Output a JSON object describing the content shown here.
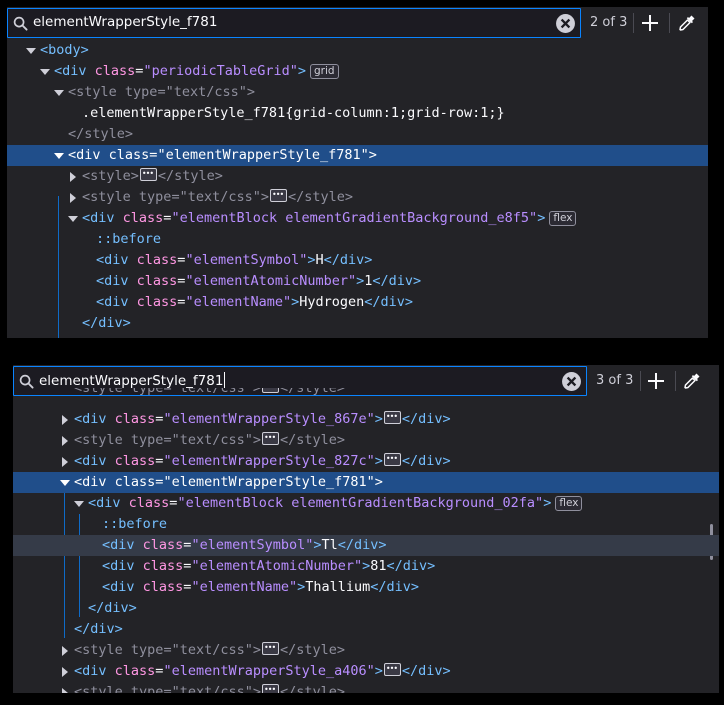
{
  "panel1": {
    "search": {
      "value": "elementWrapperStyle_f781",
      "match_count": "2 of 3"
    },
    "rows": {
      "r0": {
        "tag": "<body>"
      },
      "r1": {
        "open": "<div",
        "attr": "class",
        "val": "\"periodicTableGrid\"",
        "close": ">",
        "badge": "grid"
      },
      "r2": {
        "open": "<style",
        "attr": "type",
        "val": "\"text/css\"",
        "close": ">"
      },
      "r3": {
        "css": ".elementWrapperStyle_f781{grid-column:1;grid-row:1;}"
      },
      "r4": {
        "tag": "</style>"
      },
      "r5": {
        "open": "<div",
        "attr": "class",
        "val": "\"elementWrapperStyle_f781\"",
        "close": ">"
      },
      "r6": {
        "open": "<style>",
        "close": "</style>"
      },
      "r7": {
        "open": "<style",
        "attr": "type",
        "val": "\"text/css\"",
        "close1": ">",
        "close": "</style>"
      },
      "r8": {
        "open": "<div",
        "attr": "class",
        "val": "\"elementBlock elementGradientBackground_e8f5\"",
        "close": ">",
        "badge": "flex"
      },
      "r9": {
        "pseudo": "::before"
      },
      "r10": {
        "open": "<div",
        "attr": "class",
        "val": "\"elementSymbol\"",
        "close1": ">",
        "text": "H",
        "close": "</div>"
      },
      "r11": {
        "open": "<div",
        "attr": "class",
        "val": "\"elementAtomicNumber\"",
        "close1": ">",
        "text": "1",
        "close": "</div>"
      },
      "r12": {
        "open": "<div",
        "attr": "class",
        "val": "\"elementName\"",
        "close1": ">",
        "text": "Hydrogen",
        "close": "</div>"
      },
      "r13": {
        "tag": "</div>"
      }
    }
  },
  "panel2": {
    "search": {
      "value": "elementWrapperStyle_f781",
      "match_count": "3 of 3"
    },
    "rows": {
      "r0": {
        "open": "<style",
        "attr": "type",
        "val": "\"text/css\"",
        "close1": ">",
        "close": "</style>"
      },
      "r1": {
        "open": "<div",
        "attr": "class",
        "val": "\"elementWrapperStyle_867e\"",
        "close1": ">",
        "close": "</div>"
      },
      "r2": {
        "open": "<style",
        "attr": "type",
        "val": "\"text/css\"",
        "close1": ">",
        "close": "</style>"
      },
      "r3": {
        "open": "<div",
        "attr": "class",
        "val": "\"elementWrapperStyle_827c\"",
        "close1": ">",
        "close": "</div>"
      },
      "r4": {
        "open": "<div",
        "attr": "class",
        "val": "\"elementWrapperStyle_f781\"",
        "close": ">"
      },
      "r5": {
        "open": "<div",
        "attr": "class",
        "val": "\"elementBlock elementGradientBackground_02fa\"",
        "close": ">",
        "badge": "flex"
      },
      "r6": {
        "pseudo": "::before"
      },
      "r7": {
        "open": "<div",
        "attr": "class",
        "val": "\"elementSymbol\"",
        "close1": ">",
        "text": "Tl",
        "close": "</div>"
      },
      "r8": {
        "open": "<div",
        "attr": "class",
        "val": "\"elementAtomicNumber\"",
        "close1": ">",
        "text": "81",
        "close": "</div>"
      },
      "r9": {
        "open": "<div",
        "attr": "class",
        "val": "\"elementName\"",
        "close1": ">",
        "text": "Thallium",
        "close": "</div>"
      },
      "r10": {
        "tag": "</div>"
      },
      "r11": {
        "tag": "</div>"
      },
      "r12": {
        "open": "<style",
        "attr": "type",
        "val": "\"text/css\"",
        "close1": ">",
        "close": "</style>"
      },
      "r13": {
        "open": "<div",
        "attr": "class",
        "val": "\"elementWrapperStyle_a406\"",
        "close1": ">",
        "close": "</div>"
      },
      "r14": {
        "open": "<style",
        "attr": "type",
        "val": "\"text/css\"",
        "close1": ">",
        "close": "</style>"
      }
    }
  },
  "colors": {
    "accent": "#0a84ff",
    "selected_row": "#204e8a",
    "tag": "#75bfff",
    "attr": "#ff97e3",
    "value": "#b98eff",
    "panel_bg": "#232327"
  },
  "icons": {
    "search": "search-icon",
    "clear": "clear-search-icon",
    "add": "plus-icon",
    "picker": "eyedropper-icon"
  }
}
